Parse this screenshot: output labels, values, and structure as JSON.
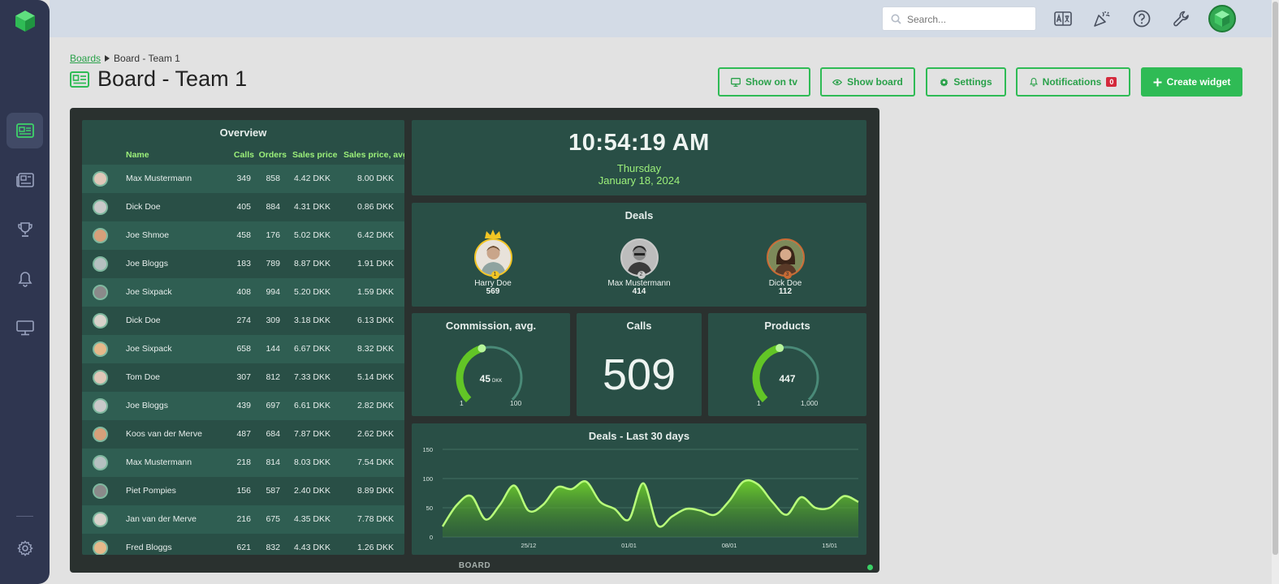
{
  "topbar": {
    "search_placeholder": "Search..."
  },
  "breadcrumb": {
    "parent": "Boards",
    "current": "Board - Team 1"
  },
  "page": {
    "title": "Board - Team 1"
  },
  "buttons": {
    "show_on_tv": "Show on tv",
    "show_board": "Show board",
    "settings": "Settings",
    "notifications": "Notifications",
    "notifications_count": "0",
    "create_widget": "Create widget"
  },
  "colors": {
    "accent": "#2fbb55",
    "sidebar": "#2f3650",
    "board_panel": "#294f46",
    "highlight_text": "#9cf07a",
    "badge": "#d42a3c"
  },
  "overview": {
    "title": "Overview",
    "columns": [
      "Name",
      "Calls",
      "Orders",
      "Sales price",
      "Sales price, avg"
    ],
    "rows": [
      {
        "name": "Max Mustermann",
        "calls": "349",
        "orders": "858",
        "price": "4.42 DKK",
        "avg": "8.00 DKK"
      },
      {
        "name": "Dick Doe",
        "calls": "405",
        "orders": "884",
        "price": "4.31 DKK",
        "avg": "0.86 DKK"
      },
      {
        "name": "Joe Shmoe",
        "calls": "458",
        "orders": "176",
        "price": "5.02 DKK",
        "avg": "6.42 DKK"
      },
      {
        "name": "Joe Bloggs",
        "calls": "183",
        "orders": "789",
        "price": "8.87 DKK",
        "avg": "1.91 DKK"
      },
      {
        "name": "Joe Sixpack",
        "calls": "408",
        "orders": "994",
        "price": "5.20 DKK",
        "avg": "1.59 DKK"
      },
      {
        "name": "Dick Doe",
        "calls": "274",
        "orders": "309",
        "price": "3.18 DKK",
        "avg": "6.13 DKK"
      },
      {
        "name": "Joe Sixpack",
        "calls": "658",
        "orders": "144",
        "price": "6.67 DKK",
        "avg": "8.32 DKK"
      },
      {
        "name": "Tom Doe",
        "calls": "307",
        "orders": "812",
        "price": "7.33 DKK",
        "avg": "5.14 DKK"
      },
      {
        "name": "Joe Bloggs",
        "calls": "439",
        "orders": "697",
        "price": "6.61 DKK",
        "avg": "2.82 DKK"
      },
      {
        "name": "Koos van der Merve",
        "calls": "487",
        "orders": "684",
        "price": "7.87 DKK",
        "avg": "2.62 DKK"
      },
      {
        "name": "Max Mustermann",
        "calls": "218",
        "orders": "814",
        "price": "8.03 DKK",
        "avg": "7.54 DKK"
      },
      {
        "name": "Piet Pompies",
        "calls": "156",
        "orders": "587",
        "price": "2.40 DKK",
        "avg": "8.89 DKK"
      },
      {
        "name": "Jan van der Merve",
        "calls": "216",
        "orders": "675",
        "price": "4.35 DKK",
        "avg": "7.78 DKK"
      },
      {
        "name": "Fred Bloggs",
        "calls": "621",
        "orders": "832",
        "price": "4.43 DKK",
        "avg": "1.26 DKK"
      }
    ]
  },
  "clock": {
    "time": "10:54:19 AM",
    "day": "Thursday",
    "date": "January 18, 2024"
  },
  "deals": {
    "title": "Deals",
    "people": [
      {
        "name": "Harry Doe",
        "value": "569",
        "rank": "1"
      },
      {
        "name": "Max Mustermann",
        "value": "414",
        "rank": "2"
      },
      {
        "name": "Dick Doe",
        "value": "112",
        "rank": "3"
      }
    ]
  },
  "commission": {
    "title": "Commission, avg.",
    "value": "45",
    "unit": "DKK",
    "min": "1",
    "max": "100",
    "fraction": 0.44
  },
  "calls": {
    "title": "Calls",
    "value": "509"
  },
  "products": {
    "title": "Products",
    "value": "447",
    "min": "1",
    "max": "1,000",
    "fraction": 0.45
  },
  "board": {
    "footer": "BOARD"
  },
  "chart_data": {
    "type": "area",
    "title": "Deals - Last 30 days",
    "xlabel": "",
    "ylabel": "",
    "ylim": [
      0,
      150
    ],
    "yticks": [
      "0",
      "50",
      "100",
      "150"
    ],
    "xtick_labels": [
      "25/12",
      "01/01",
      "08/01",
      "15/01"
    ],
    "xtick_index": [
      6,
      13,
      20,
      27
    ],
    "series": [
      {
        "values": [
          18,
          55,
          70,
          30,
          55,
          88,
          45,
          55,
          85,
          82,
          95,
          60,
          48,
          30,
          92,
          20,
          35,
          48,
          45,
          38,
          62,
          95,
          90,
          60,
          38,
          68,
          50,
          50,
          70,
          60
        ]
      }
    ],
    "grid": true
  }
}
